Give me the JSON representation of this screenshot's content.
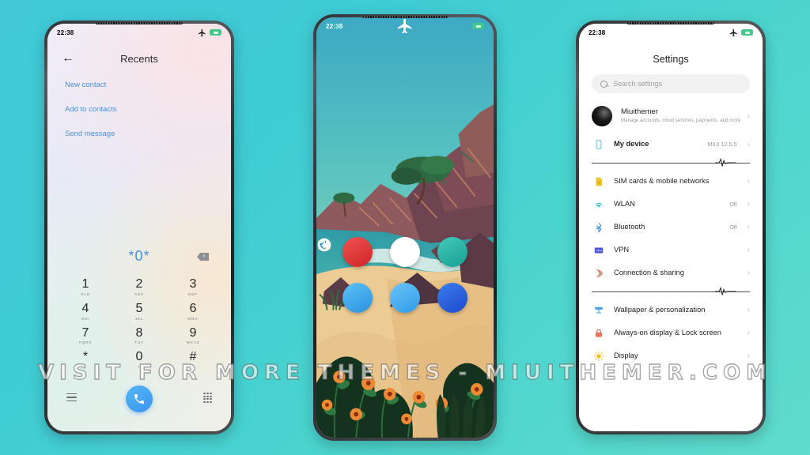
{
  "background": {
    "color_start": "#41c9d8",
    "color_end": "#5fdccb"
  },
  "watermark": {
    "text": "VISIT FOR MORE THEMES - MIUITHEMER.COM"
  },
  "status_bar": {
    "time": "22:38",
    "airplane_icon": "airplane-icon",
    "battery_icon": "battery-icon",
    "battery_color": "#41c98a"
  },
  "phone_left": {
    "name": "dialer-phone",
    "header": {
      "back_icon": "back-arrow-icon",
      "title": "Recents"
    },
    "actions": [
      {
        "label": "New contact"
      },
      {
        "label": "Add to contacts"
      },
      {
        "label": "Send message"
      }
    ],
    "accent_color": "#4a90d9",
    "dialed_number": "*0*",
    "backspace_icon": "backspace-icon",
    "keypad": [
      {
        "num": "1",
        "letters": "OLD"
      },
      {
        "num": "2",
        "letters": "ABC"
      },
      {
        "num": "3",
        "letters": "DEF"
      },
      {
        "num": "4",
        "letters": "GHI"
      },
      {
        "num": "5",
        "letters": "JKL"
      },
      {
        "num": "6",
        "letters": "MNO"
      },
      {
        "num": "7",
        "letters": "PQRS"
      },
      {
        "num": "8",
        "letters": "TUV"
      },
      {
        "num": "9",
        "letters": "WXYZ"
      },
      {
        "num": "*",
        "letters": ","
      },
      {
        "num": "0",
        "letters": "+"
      },
      {
        "num": "#",
        "letters": ";"
      }
    ],
    "bottom_bar": {
      "menu_icon": "menu-icon",
      "call_icon": "call-icon",
      "call_button_color": "#3b95ef",
      "keypad_icon": "keypad-dots-icon"
    }
  },
  "phone_middle": {
    "name": "home-screen-phone",
    "wallpaper": {
      "description": "flat illustration coastal cliffs with tree, sea and flowers",
      "sky_color": "#49b7bd",
      "sea_color": "#2f9aa6",
      "sand_color": "#eccb94",
      "cliff_color": "#7a4a52",
      "flower_color": "#e98733"
    },
    "apps": [
      {
        "name": "recorder",
        "icon": "microphone-icon",
        "color": "#e23b3b"
      },
      {
        "name": "file-manager",
        "icon": "folder-icon",
        "color": "#ffffff"
      },
      {
        "name": "camera-video",
        "icon": "video-camera-icon",
        "color": "#2bb5a8"
      },
      {
        "name": "browser",
        "icon": "globe-icon",
        "color": "#39a9ee"
      },
      {
        "name": "downloads",
        "icon": "download-arrow-icon",
        "color": "#44b0ef"
      },
      {
        "name": "control-center",
        "icon": "compass-icon",
        "color": "#2766e0"
      }
    ]
  },
  "phone_right": {
    "name": "settings-phone",
    "title": "Settings",
    "search": {
      "placeholder": "Search settings",
      "icon": "search-icon"
    },
    "profile": {
      "name": "Miuithemer",
      "subtitle": "Manage accounts, cloud services, payments, and more",
      "avatar_icon": "avatar"
    },
    "rows_top": [
      {
        "label": "My device",
        "value": "MIUI 12.5.5",
        "icon": "phone-outline-icon",
        "color": "#5bc8ef",
        "strong": true
      }
    ],
    "rows_mid": [
      {
        "label": "SIM cards & mobile networks",
        "value": "",
        "icon": "sim-card-icon",
        "color": "#f3c32c"
      },
      {
        "label": "WLAN",
        "value": "Off",
        "icon": "wifi-icon",
        "color": "#3fc4c9"
      },
      {
        "label": "Bluetooth",
        "value": "Off",
        "icon": "bluetooth-icon",
        "color": "#2f8cf0"
      },
      {
        "label": "VPN",
        "value": "",
        "icon": "vpn-icon",
        "color": "#4a52e0"
      },
      {
        "label": "Connection & sharing",
        "value": "",
        "icon": "connection-sharing-icon",
        "color": "#e8604c"
      }
    ],
    "rows_bottom": [
      {
        "label": "Wallpaper & personalization",
        "value": "",
        "icon": "wallpaper-icon",
        "color": "#3f9fe0"
      },
      {
        "label": "Always-on display & Lock screen",
        "value": "",
        "icon": "lock-icon",
        "color": "#e8604c"
      },
      {
        "label": "Display",
        "value": "",
        "icon": "brightness-icon",
        "color": "#f5c11e"
      }
    ],
    "chevron_icon": "chevron-right-icon",
    "divider_icon": "heartbeat-divider-icon"
  }
}
